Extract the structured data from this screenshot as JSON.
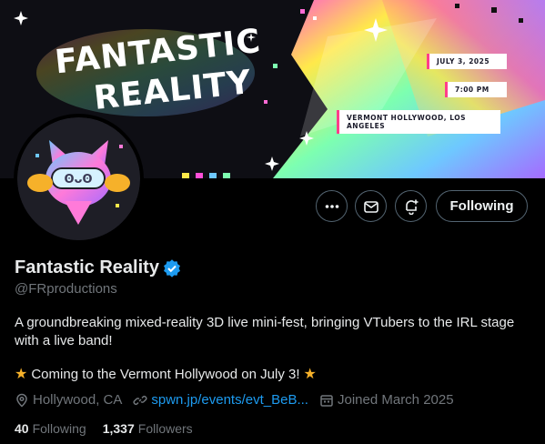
{
  "banner": {
    "title_line1": "FANTASTIC",
    "title_line2": "REALITY",
    "date": "JULY 3, 2025",
    "time": "7:00 PM",
    "venue": "VERMONT HOLLYWOOD, LOS ANGELES"
  },
  "actions": {
    "more_icon": "more-icon",
    "message_icon": "mail-icon",
    "notify_icon": "bell-plus-icon",
    "follow_label": "Following"
  },
  "profile": {
    "display_name": "Fantastic Reality",
    "verified_icon": "verified-badge-icon",
    "handle": "@FRproductions",
    "bio_line1": "A groundbreaking mixed-reality 3D live mini-fest, bringing VTubers to the IRL stage with a live band!",
    "bio_line2": "Coming to the Vermont Hollywood on July 3!",
    "location": "Hollywood, CA",
    "link": "spwn.jp/events/evt_BeB...",
    "joined": "Joined March 2025"
  },
  "stats": {
    "following_count": "40",
    "following_label": "Following",
    "followers_count": "1,337",
    "followers_label": "Followers"
  },
  "colors": {
    "background": "#000000",
    "accent": "#1d9bf0",
    "muted": "#71767b",
    "star": "#f6b12a"
  }
}
